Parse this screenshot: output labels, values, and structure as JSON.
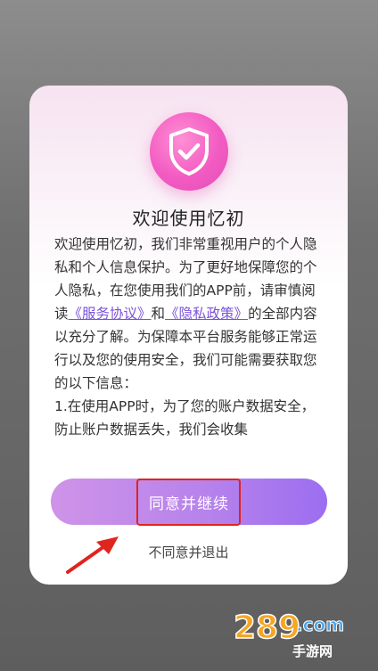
{
  "dialog": {
    "icon": "shield-check-icon",
    "title": "欢迎使用忆初",
    "body": {
      "intro": "欢迎使用忆初，我们非常重视用户的个人隐私和个人信息保护。为了更好地保障您的个人隐私，在您使用我们的APP前，请审慎阅读",
      "service_link": "《服务协议》",
      "and": "和",
      "privacy_link": "《隐私政策》",
      "rest": "的全部内容以充分了解。为保障本平台服务能够正常运行以及您的使用安全，我们可能需要获取您的以下信息：",
      "item1": "1.在使用APP时，为了您的账户数据安全，防止账户数据丢失，我们会收集"
    },
    "agree_label": "同意并继续",
    "decline_label": "不同意并退出"
  },
  "annotation": {
    "color": "#e0241e",
    "icon": "red-arrow-icon"
  },
  "watermark": {
    "text": "289",
    "text2": ".com",
    "sub": "手游网"
  },
  "colors": {
    "accent": "#9c6ef0",
    "link": "#7a52d9",
    "shield": "#f25bc2"
  }
}
